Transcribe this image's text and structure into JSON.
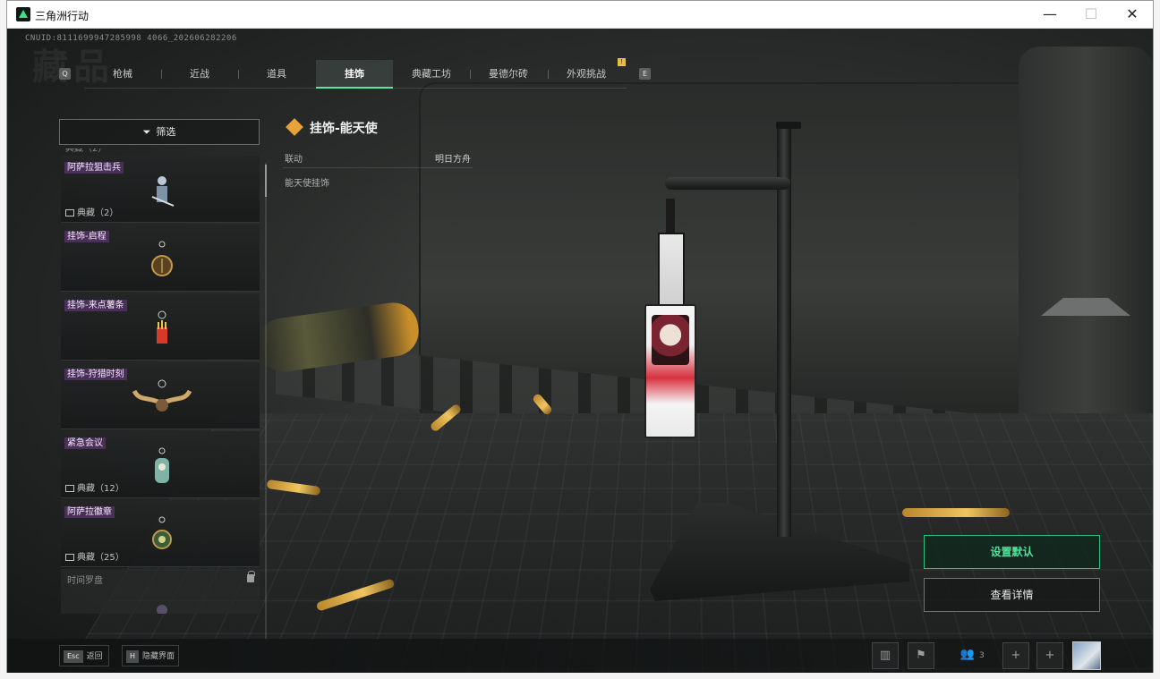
{
  "window": {
    "title": "三角洲行动",
    "minimize": "—",
    "maximize": "☐",
    "close": "✕"
  },
  "header": {
    "cnuid": "CNUID:8111699947285998 4066_202606282206",
    "ghost_title": "藏品"
  },
  "tabs": {
    "prev_key": "Q",
    "next_key": "E",
    "items": [
      "枪械",
      "近战",
      "道具",
      "挂饰",
      "典藏工坊",
      "曼德尔砖",
      "外观挑战"
    ],
    "active": "挂饰",
    "badge": "!"
  },
  "filter": {
    "label": "筛选",
    "icon": "filter-icon"
  },
  "list": {
    "partial_top": "典藏（2）",
    "items": [
      {
        "name": "阿萨拉狙击兵",
        "collection": "典藏（2）"
      },
      {
        "name": "挂饰-启程",
        "collection": ""
      },
      {
        "name": "挂饰-来点薯条",
        "collection": ""
      },
      {
        "name": "挂饰-狩猎时刻",
        "collection": ""
      },
      {
        "name": "紧急会议",
        "collection": "典藏（12）"
      },
      {
        "name": "阿萨拉徽章",
        "collection": "典藏（25）"
      },
      {
        "name": "时间罗盘",
        "collection": "",
        "locked": true
      }
    ]
  },
  "detail": {
    "title": "挂饰-能天使",
    "row_key": "联动",
    "row_value": "明日方舟",
    "description": "能天使挂饰"
  },
  "actions": {
    "set_default": "设置默认",
    "view_details": "查看详情"
  },
  "bottom": {
    "back_key": "Esc",
    "back_label": "返回",
    "hide_key": "H",
    "hide_label": "隐藏界面",
    "friends_count": "3",
    "plus1": "+",
    "plus2": "+"
  },
  "colors": {
    "accent_green": "#4de39a",
    "tab_active_underline": "#5fe3a1",
    "name_tag_bg": "#4a2f5a",
    "diamond_icon": "#e7a23a"
  }
}
